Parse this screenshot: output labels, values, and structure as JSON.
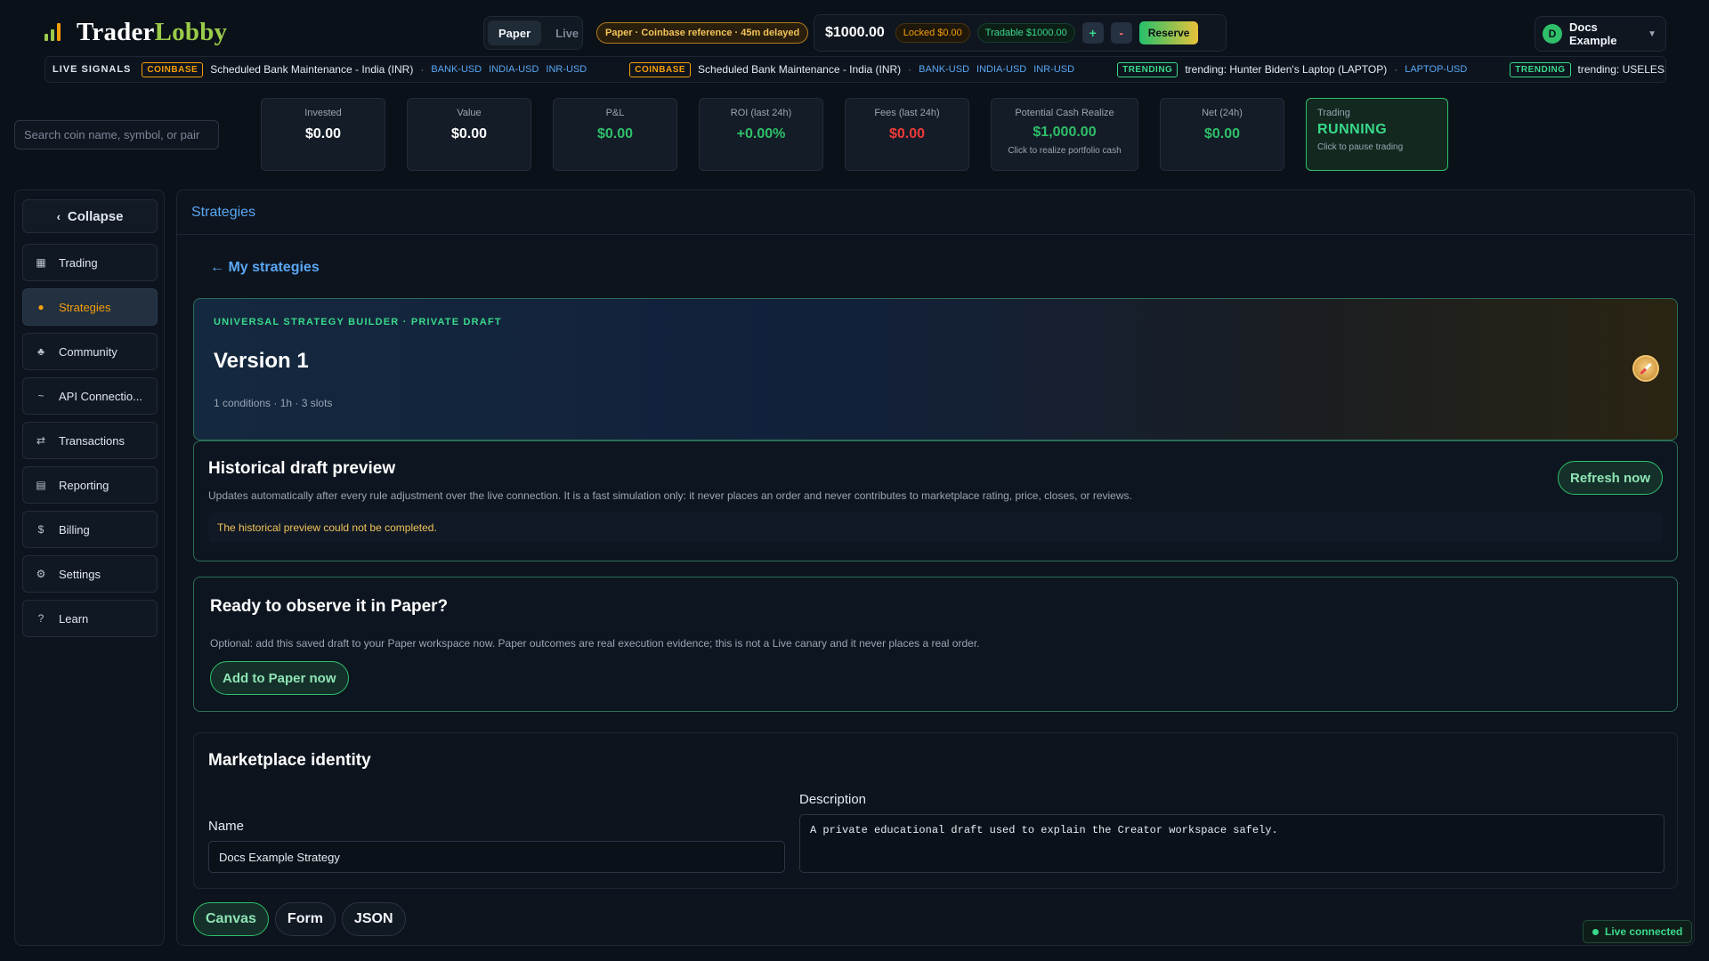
{
  "app": {
    "logo_part1": "Trader",
    "logo_part2": "Lobby"
  },
  "header": {
    "mode_paper": "Paper",
    "mode_live": "Live",
    "reference_badge": "Paper · Coinbase reference · 45m delayed",
    "balance": "$1000.00",
    "locked": "Locked $0.00",
    "tradable": "Tradable $1000.00",
    "plus": "+",
    "minus": "-",
    "reserve": "Reserve",
    "user_initial": "D",
    "user_name": "Docs Example"
  },
  "ticker": {
    "title": "LIVE SIGNALS",
    "items": [
      {
        "tag": "COINBASE",
        "text": "Scheduled Bank Maintenance - India (INR)",
        "symbols": [
          "BANK-USD",
          "INDIA-USD",
          "INR-USD"
        ]
      },
      {
        "tag": "COINBASE",
        "text": "Scheduled Bank Maintenance - India (INR)",
        "symbols": [
          "BANK-USD",
          "INDIA-USD",
          "INR-USD"
        ]
      },
      {
        "tag": "TRENDING",
        "text": "trending: Hunter Biden's Laptop (LAPTOP)",
        "symbols": [
          "LAPTOP-USD"
        ]
      },
      {
        "tag": "TRENDING",
        "text": "trending: USELESS STONK (STONK"
      }
    ]
  },
  "search": {
    "placeholder": "Search coin name, symbol, or pair"
  },
  "stats": {
    "invested_label": "Invested",
    "invested_value": "$0.00",
    "value_label": "Value",
    "value_value": "$0.00",
    "pnl_label": "P&L",
    "pnl_value": "$0.00",
    "roi_label": "ROI (last 24h)",
    "roi_value": "+0.00%",
    "fees_label": "Fees (last 24h)",
    "fees_value": "$0.00",
    "cash_label": "Potential Cash Realize",
    "cash_value": "$1,000.00",
    "cash_sub": "Click to realize portfolio cash",
    "net_label": "Net (24h)",
    "net_value": "$0.00",
    "trading_label": "Trading",
    "trading_value": "RUNNING",
    "trading_sub": "Click to pause trading"
  },
  "sidebar": {
    "collapse": "Collapse",
    "items": [
      {
        "label": "Trading"
      },
      {
        "label": "Strategies"
      },
      {
        "label": "Community"
      },
      {
        "label": "API Connectio..."
      },
      {
        "label": "Transactions"
      },
      {
        "label": "Reporting"
      },
      {
        "label": "Billing"
      },
      {
        "label": "Settings"
      },
      {
        "label": "Learn"
      }
    ]
  },
  "main": {
    "header": "Strategies",
    "back_link": "← My strategies",
    "hero": {
      "kicker": "UNIVERSAL STRATEGY BUILDER · PRIVATE DRAFT",
      "title": "Version 1",
      "meta": "1 conditions · 1h · 3 slots"
    },
    "history": {
      "title": "Historical draft preview",
      "description": "Updates automatically after every rule adjustment over the live connection. It is a fast simulation only: it never places an order and never contributes to marketplace rating, price, closes, or reviews.",
      "error": "The historical preview could not be completed.",
      "refresh": "Refresh now"
    },
    "observe": {
      "title": "Ready to observe it in Paper?",
      "description": "Optional: add this saved draft to your Paper workspace now. Paper outcomes are real execution evidence; this is not a Live canary and it never places a real order.",
      "button": "Add to Paper now"
    },
    "marketplace": {
      "title": "Marketplace identity",
      "name_label": "Name",
      "name_value": "Docs Example Strategy",
      "description_label": "Description",
      "description_value": "A private educational draft used to explain the Creator workspace safely."
    },
    "tabs": [
      "Canvas",
      "Form",
      "JSON"
    ]
  },
  "status": {
    "live_connected": "Live connected"
  }
}
